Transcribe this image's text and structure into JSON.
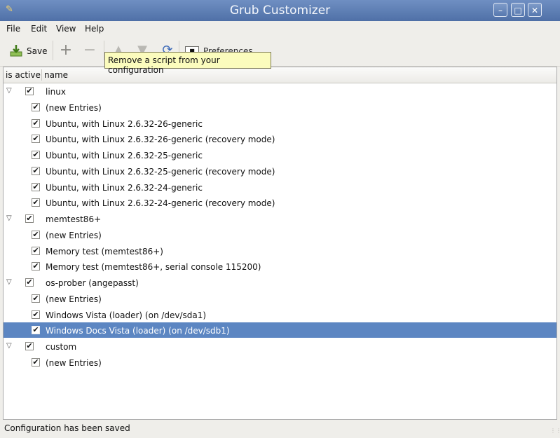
{
  "window": {
    "title": "Grub Customizer"
  },
  "menu": [
    "File",
    "Edit",
    "View",
    "Help"
  ],
  "toolbar": {
    "save_label": "Save",
    "preferences_label": "Preferences"
  },
  "tooltip": "Remove a script from your configuration",
  "columns": {
    "is_active": "is active",
    "name": "name"
  },
  "tree": [
    {
      "label": "linux",
      "level": 0,
      "checked": true
    },
    {
      "label": "(new Entries)",
      "level": 1,
      "checked": true
    },
    {
      "label": "Ubuntu, with Linux 2.6.32-26-generic",
      "level": 1,
      "checked": true
    },
    {
      "label": "Ubuntu, with Linux 2.6.32-26-generic (recovery mode)",
      "level": 1,
      "checked": true
    },
    {
      "label": "Ubuntu, with Linux 2.6.32-25-generic",
      "level": 1,
      "checked": true
    },
    {
      "label": "Ubuntu, with Linux 2.6.32-25-generic (recovery mode)",
      "level": 1,
      "checked": true
    },
    {
      "label": "Ubuntu, with Linux 2.6.32-24-generic",
      "level": 1,
      "checked": true
    },
    {
      "label": "Ubuntu, with Linux 2.6.32-24-generic (recovery mode)",
      "level": 1,
      "checked": true
    },
    {
      "label": "memtest86+",
      "level": 0,
      "checked": true
    },
    {
      "label": "(new Entries)",
      "level": 1,
      "checked": true
    },
    {
      "label": "Memory test (memtest86+)",
      "level": 1,
      "checked": true
    },
    {
      "label": "Memory test (memtest86+, serial console 115200)",
      "level": 1,
      "checked": true
    },
    {
      "label": "os-prober (angepasst)",
      "level": 0,
      "checked": true
    },
    {
      "label": "(new Entries)",
      "level": 1,
      "checked": true
    },
    {
      "label": "Windows Vista (loader) (on /dev/sda1)",
      "level": 1,
      "checked": true
    },
    {
      "label": "Windows Docs Vista (loader) (on /dev/sdb1)",
      "level": 1,
      "checked": true,
      "selected": true
    },
    {
      "label": "custom",
      "level": 0,
      "checked": true
    },
    {
      "label": "(new Entries)",
      "level": 1,
      "checked": true
    }
  ],
  "status": "Configuration has been saved",
  "colors": {
    "titlebar": "#5b7cb3",
    "selection": "#5c86c2",
    "tooltip_bg": "#fbfcbd"
  }
}
